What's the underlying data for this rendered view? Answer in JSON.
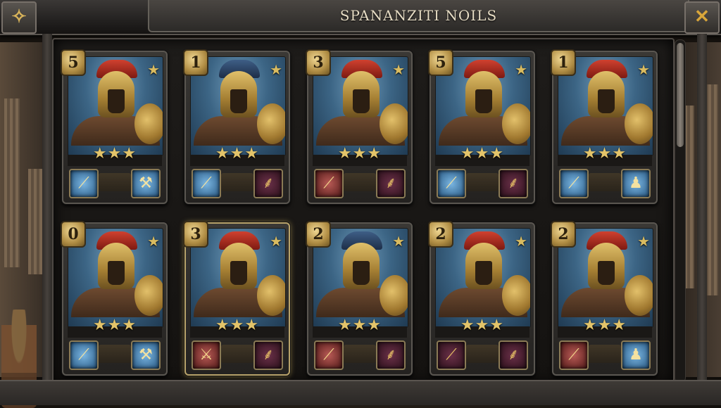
{
  "title": "SPANANZITI NOILS",
  "top_left_button": "✧",
  "close_button": "✕",
  "cards": [
    {
      "level": "5",
      "crest": "red",
      "stars": "★★★",
      "corner_star": "★",
      "skill_left": {
        "icon": "spear-icon",
        "glyph": "⟋",
        "color": "blue"
      },
      "skill_right": {
        "icon": "warrior-silhouette-icon",
        "glyph": "⚒",
        "color": "blue"
      }
    },
    {
      "level": "1",
      "crest": "blue",
      "stars": "★★★",
      "corner_star": "★",
      "skill_left": {
        "icon": "spear-icon",
        "glyph": "⟋",
        "color": "blue"
      },
      "skill_right": {
        "icon": "laurel-icon",
        "glyph": "⸙",
        "color": "purple"
      }
    },
    {
      "level": "3",
      "crest": "red",
      "stars": "★★★",
      "corner_star": "★",
      "skill_left": {
        "icon": "spear-icon",
        "glyph": "⟋",
        "color": "red"
      },
      "skill_right": {
        "icon": "laurel-icon",
        "glyph": "⸙",
        "color": "purple"
      }
    },
    {
      "level": "5",
      "crest": "red",
      "stars": "★★★",
      "corner_star": "★",
      "skill_left": {
        "icon": "spear-icon",
        "glyph": "⟋",
        "color": "blue"
      },
      "skill_right": {
        "icon": "laurel-icon",
        "glyph": "⸙",
        "color": "purple"
      }
    },
    {
      "level": "1",
      "crest": "red",
      "stars": "★★★",
      "corner_star": "★",
      "skill_left": {
        "icon": "spear-icon",
        "glyph": "⟋",
        "color": "blue"
      },
      "skill_right": {
        "icon": "warrior-silhouette-icon",
        "glyph": "♟",
        "color": "blue"
      }
    },
    {
      "level": "0",
      "crest": "red",
      "stars": "★★★",
      "corner_star": "★",
      "skill_left": {
        "icon": "spear-icon",
        "glyph": "⟋",
        "color": "blue"
      },
      "skill_right": {
        "icon": "warrior-silhouette-icon",
        "glyph": "⚒",
        "color": "blue"
      }
    },
    {
      "level": "3",
      "crest": "red",
      "stars": "★★★",
      "corner_star": "★",
      "skill_left": {
        "icon": "crossed-spears-icon",
        "glyph": "⚔",
        "color": "red"
      },
      "skill_right": {
        "icon": "blade-icon",
        "glyph": "⸙",
        "color": "purple"
      },
      "selected": true
    },
    {
      "level": "2",
      "crest": "blue",
      "stars": "★★★",
      "corner_star": "★",
      "skill_left": {
        "icon": "spear-icon",
        "glyph": "⟋",
        "color": "red"
      },
      "skill_right": {
        "icon": "laurel-icon",
        "glyph": "⸙",
        "color": "purple"
      }
    },
    {
      "level": "2",
      "crest": "red",
      "stars": "★★★",
      "corner_star": "★",
      "skill_left": {
        "icon": "spear-icon",
        "glyph": "⟋",
        "color": "purple"
      },
      "skill_right": {
        "icon": "blade-icon",
        "glyph": "⸙",
        "color": "purple"
      }
    },
    {
      "level": "2",
      "crest": "red",
      "stars": "★★★",
      "corner_star": "★",
      "skill_left": {
        "icon": "spear-icon",
        "glyph": "⟋",
        "color": "red"
      },
      "skill_right": {
        "icon": "warrior-silhouette-icon",
        "glyph": "♟",
        "color": "blue"
      }
    }
  ]
}
